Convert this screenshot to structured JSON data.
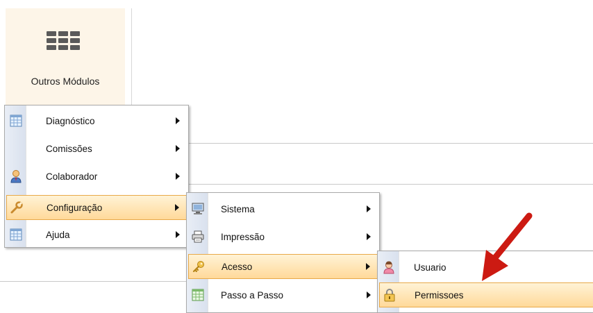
{
  "module": {
    "label": "Outros Módulos",
    "icon": "grid-icon"
  },
  "menu_main": {
    "items": [
      {
        "label": "Diagnóstico",
        "icon": "table-icon",
        "has_submenu": true,
        "selected": false
      },
      {
        "label": "Comissões",
        "icon": "",
        "has_submenu": true,
        "selected": false
      },
      {
        "label": "Colaborador",
        "icon": "person-icon",
        "has_submenu": true,
        "selected": false
      },
      {
        "label": "Configuração",
        "icon": "wrench-icon",
        "has_submenu": true,
        "selected": true
      },
      {
        "label": "Ajuda",
        "icon": "table-icon",
        "has_submenu": true,
        "selected": false
      }
    ]
  },
  "menu_config": {
    "items": [
      {
        "label": "Sistema",
        "icon": "monitor-icon",
        "has_submenu": true,
        "selected": false
      },
      {
        "label": "Impressão",
        "icon": "printer-icon",
        "has_submenu": true,
        "selected": false
      },
      {
        "label": "Acesso",
        "icon": "key-icon",
        "has_submenu": true,
        "selected": true
      },
      {
        "label": "Passo a Passo",
        "icon": "table-icon",
        "has_submenu": true,
        "selected": false
      }
    ]
  },
  "menu_acesso": {
    "items": [
      {
        "label": "Usuario",
        "icon": "user-icon",
        "selected": false
      },
      {
        "label": "Permissoes",
        "icon": "lock-icon",
        "selected": true
      }
    ]
  },
  "annotation": {
    "icon": "red-arrow-icon",
    "color": "#cc1a12"
  }
}
